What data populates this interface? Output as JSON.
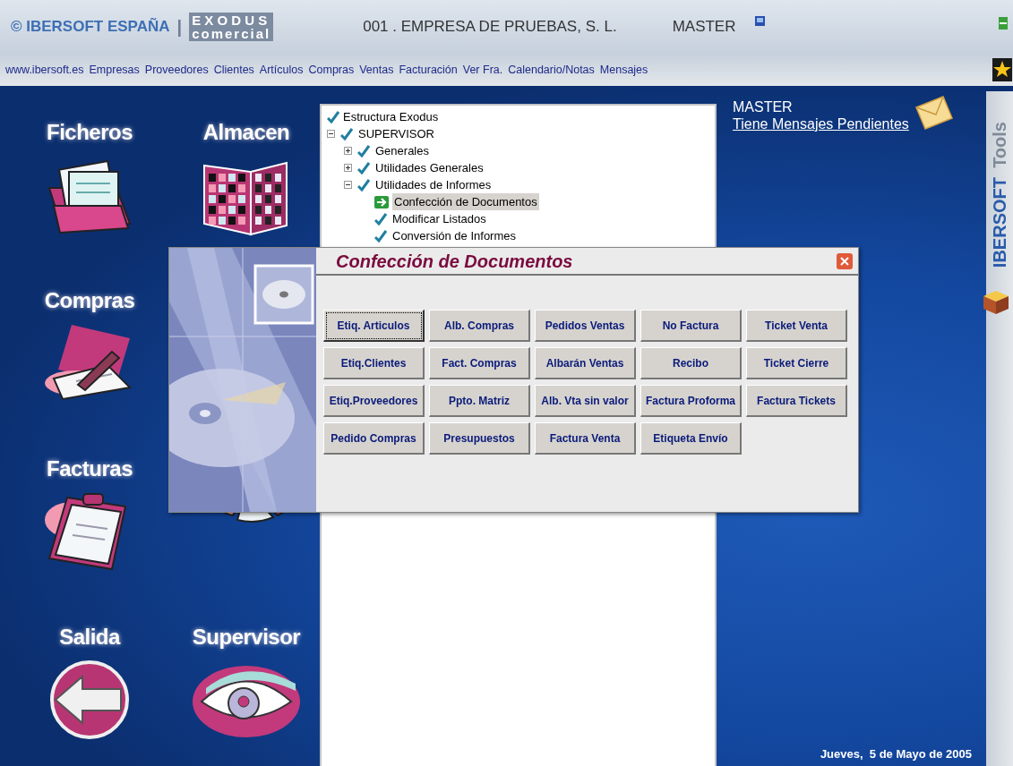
{
  "header": {
    "brand": "© IBERSOFT ESPAÑA",
    "separator": "|",
    "product_top": "E X O D U S",
    "product_bottom": "comercial",
    "company": "001 . EMPRESA DE PRUEBAS, S. L.",
    "user": "MASTER"
  },
  "nav": [
    "www.ibersoft.es",
    "Empresas",
    "Proveedores",
    "Clientes",
    "Artículos",
    "Compras",
    "Ventas",
    "Facturación",
    "Ver Fra.",
    "Calendario/Notas",
    "Mensajes"
  ],
  "modules": [
    {
      "label": "Ficheros",
      "kind": "files"
    },
    {
      "label": "Almacen",
      "kind": "warehouse"
    },
    {
      "label": "Compras",
      "kind": "purchase"
    },
    {
      "kind": "hidden"
    },
    {
      "label": "Facturas",
      "kind": "invoice"
    },
    {
      "kind": "chart"
    },
    {
      "label": "Salida",
      "kind": "exit"
    },
    {
      "label": "Supervisor",
      "kind": "eye"
    }
  ],
  "tree": {
    "root": {
      "label": "Estructura Exodus",
      "kind": "check"
    },
    "items": [
      {
        "label": "SUPERVISOR",
        "kind": "check",
        "expanded": true,
        "children": [
          {
            "label": "Generales",
            "kind": "check",
            "expanded": false
          },
          {
            "label": "Utilidades Generales",
            "kind": "check",
            "expanded": false
          },
          {
            "label": "Utilidades de Informes",
            "kind": "check",
            "expanded": true,
            "children": [
              {
                "label": "Confección de Documentos",
                "kind": "arrow",
                "selected": true
              },
              {
                "label": "Modificar Listados",
                "kind": "check",
                "selected": false
              },
              {
                "label": "Conversión de Informes",
                "kind": "check",
                "selected": false
              }
            ]
          }
        ]
      }
    ]
  },
  "messages": {
    "user": "MASTER",
    "link": "Tiene Mensajes Pendientes"
  },
  "side": {
    "brand": "IBERSOFT",
    "tools": "Tools"
  },
  "date": "Jueves,  5 de Mayo de 2005",
  "dialog": {
    "title": "Confección de Documentos",
    "buttons": [
      {
        "label": "Etiq. Articulos",
        "focused": true
      },
      {
        "label": "Alb. Compras",
        "focused": false
      },
      {
        "label": "Pedidos Ventas",
        "focused": false
      },
      {
        "label": "No Factura",
        "focused": false
      },
      {
        "label": "Ticket Venta",
        "focused": false
      },
      {
        "label": "Etiq.Clientes",
        "focused": false
      },
      {
        "label": "Fact. Compras",
        "focused": false
      },
      {
        "label": "Albarán Ventas",
        "focused": false
      },
      {
        "label": "Recibo",
        "focused": false
      },
      {
        "label": "Ticket Cierre",
        "focused": false
      },
      {
        "label": "Etiq.Proveedores",
        "focused": false
      },
      {
        "label": "Ppto. Matriz",
        "focused": false
      },
      {
        "label": "Alb. Vta sin valor",
        "focused": false
      },
      {
        "label": "Factura Proforma",
        "focused": false
      },
      {
        "label": "Factura Tickets",
        "focused": false
      },
      {
        "label": "Pedido Compras",
        "focused": false
      },
      {
        "label": "Presupuestos",
        "focused": false
      },
      {
        "label": "Factura Venta",
        "focused": false
      },
      {
        "label": "Etiqueta Envío",
        "focused": false
      }
    ]
  }
}
